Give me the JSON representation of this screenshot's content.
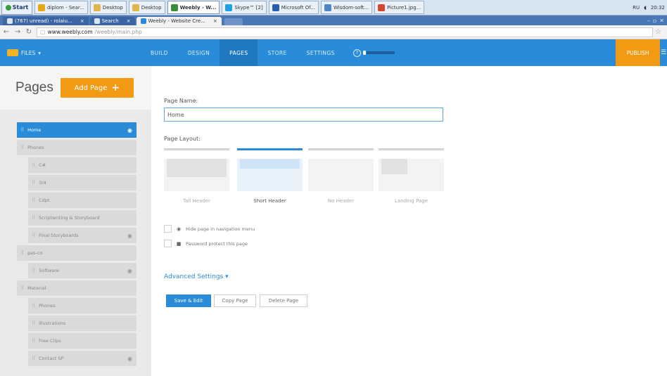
{
  "taskbar": {
    "start_label": "Start",
    "items": [
      {
        "label": "diplom - Sear...",
        "color": "#e6a817"
      },
      {
        "label": "Desktop",
        "color": "#e0b54a"
      },
      {
        "label": "Desktop",
        "color": "#e0b54a"
      },
      {
        "label": "Weebly - W...",
        "color": "#3a8e3a",
        "active": true
      },
      {
        "label": "Skype™ [2]",
        "color": "#1ea0e4"
      },
      {
        "label": "Microsoft Of...",
        "color": "#2b5bab"
      },
      {
        "label": "Wisdom-soft...",
        "color": "#4f86c6"
      },
      {
        "label": "Picture1.jpg...",
        "color": "#d9442d"
      }
    ],
    "lang": "RU",
    "clock": "20:32"
  },
  "browser": {
    "tabs": [
      {
        "label": "(767) unread) - rolaiu...",
        "active": false
      },
      {
        "label": "Search",
        "active": false
      },
      {
        "label": "Weebly - Website Cre...",
        "active": true
      }
    ],
    "url_host": "www.weebly.com",
    "url_path": "/weebly/main.php"
  },
  "nav": {
    "site_label": "FILES",
    "tabs": [
      {
        "label": "BUILD",
        "active": false
      },
      {
        "label": "DESIGN",
        "active": false
      },
      {
        "label": "PAGES",
        "active": true
      },
      {
        "label": "STORE",
        "active": false
      },
      {
        "label": "SETTINGS",
        "active": false
      }
    ],
    "help_label": "?",
    "publish_label": "PUBLISH",
    "menu_glyph": "☰"
  },
  "sidebar": {
    "title": "Pages",
    "add_page_label": "Add Page",
    "pages": [
      {
        "label": "Home",
        "level": 1,
        "active": true,
        "sub": true
      },
      {
        "label": "Phones",
        "level": 1
      },
      {
        "label": "C#",
        "level": 2
      },
      {
        "label": "3/4",
        "level": 2
      },
      {
        "label": "Cdpt",
        "level": 2
      },
      {
        "label": "Scriptwriting & Storyboard",
        "level": 2
      },
      {
        "label": "Final Storyboards",
        "level": 2,
        "sub": true
      },
      {
        "label": "pas-co",
        "level": 1
      },
      {
        "label": "Software",
        "level": 2,
        "sub": true
      },
      {
        "label": "Material",
        "level": 1
      },
      {
        "label": "Phones",
        "level": 2
      },
      {
        "label": "Illustrations",
        "level": 2
      },
      {
        "label": "Free Clips",
        "level": 2
      },
      {
        "label": "Contact SP",
        "level": 2,
        "sub": true
      }
    ]
  },
  "form": {
    "page_name_label": "Page Name:",
    "page_name_value": "Home",
    "layout_label": "Page Layout:",
    "layouts": [
      {
        "label": "Tall Header",
        "selected": false
      },
      {
        "label": "Short Header",
        "selected": true
      },
      {
        "label": "No Header",
        "selected": false
      },
      {
        "label": "Landing Page",
        "selected": false
      }
    ],
    "hide_label": "Hide page in navigation menu",
    "password_label": "Password protect this page",
    "advanced_label": "Advanced Settings",
    "save_label": "Save & Edit",
    "copy_label": "Copy Page",
    "delete_label": "Delete Page"
  }
}
